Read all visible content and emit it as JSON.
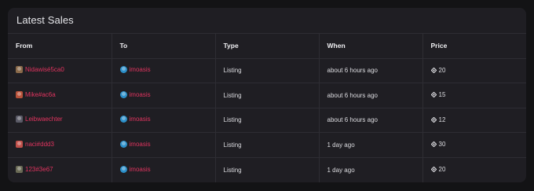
{
  "title": "Latest Sales",
  "columns": [
    "From",
    "To",
    "Type",
    "When",
    "Price"
  ],
  "rows": [
    {
      "from": "Nidawisé5ca0",
      "from_avatar_color": "#8a6a4a",
      "to": "imoasis",
      "to_avatar_color": "#2c8fc9",
      "type": "Listing",
      "when": "about 6 hours ago",
      "price": "20"
    },
    {
      "from": "Mike#ac6a",
      "from_avatar_color": "#b8523a",
      "to": "imoasis",
      "to_avatar_color": "#2c8fc9",
      "type": "Listing",
      "when": "about 6 hours ago",
      "price": "15"
    },
    {
      "from": "Leibwaechter",
      "from_avatar_color": "#5a5a66",
      "to": "imoasis",
      "to_avatar_color": "#2c8fc9",
      "type": "Listing",
      "when": "about 6 hours ago",
      "price": "12"
    },
    {
      "from": "naci#ddd3",
      "from_avatar_color": "#c0504a",
      "to": "imoasis",
      "to_avatar_color": "#2c8fc9",
      "type": "Listing",
      "when": "1 day ago",
      "price": "30"
    },
    {
      "from": "123#3e67",
      "from_avatar_color": "#6a6a55",
      "to": "imoasis",
      "to_avatar_color": "#2c8fc9",
      "type": "Listing",
      "when": "1 day ago",
      "price": "20"
    }
  ],
  "colors": {
    "link": "#e0345f",
    "panel_bg": "#1f1e23",
    "page_bg": "#131315"
  },
  "icons": {
    "price": "currency-diamond-icon"
  }
}
